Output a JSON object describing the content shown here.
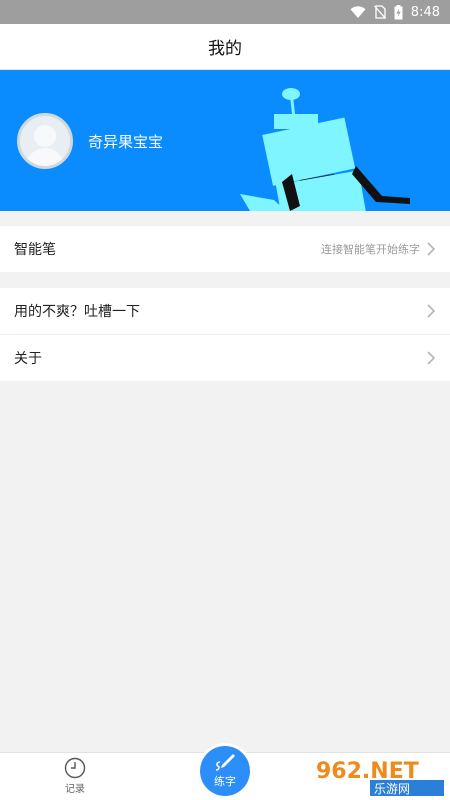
{
  "status_bar": {
    "time": "8:48"
  },
  "header": {
    "title": "我的"
  },
  "profile": {
    "username": "奇异果宝宝"
  },
  "settings": {
    "smart_pen": {
      "label": "智能笔",
      "hint": "连接智能笔开始练字"
    },
    "feedback": {
      "label": "用的不爽？吐槽一下"
    },
    "about": {
      "label": "关于"
    }
  },
  "bottom_nav": {
    "records_label": "记录",
    "practice_label": "练字"
  },
  "watermark": {
    "brand": "962.NET",
    "sub": "乐游网"
  },
  "colors": {
    "accent": "#0a8cff",
    "fab": "#2c8ef8",
    "robot": "#7ff5ff"
  }
}
